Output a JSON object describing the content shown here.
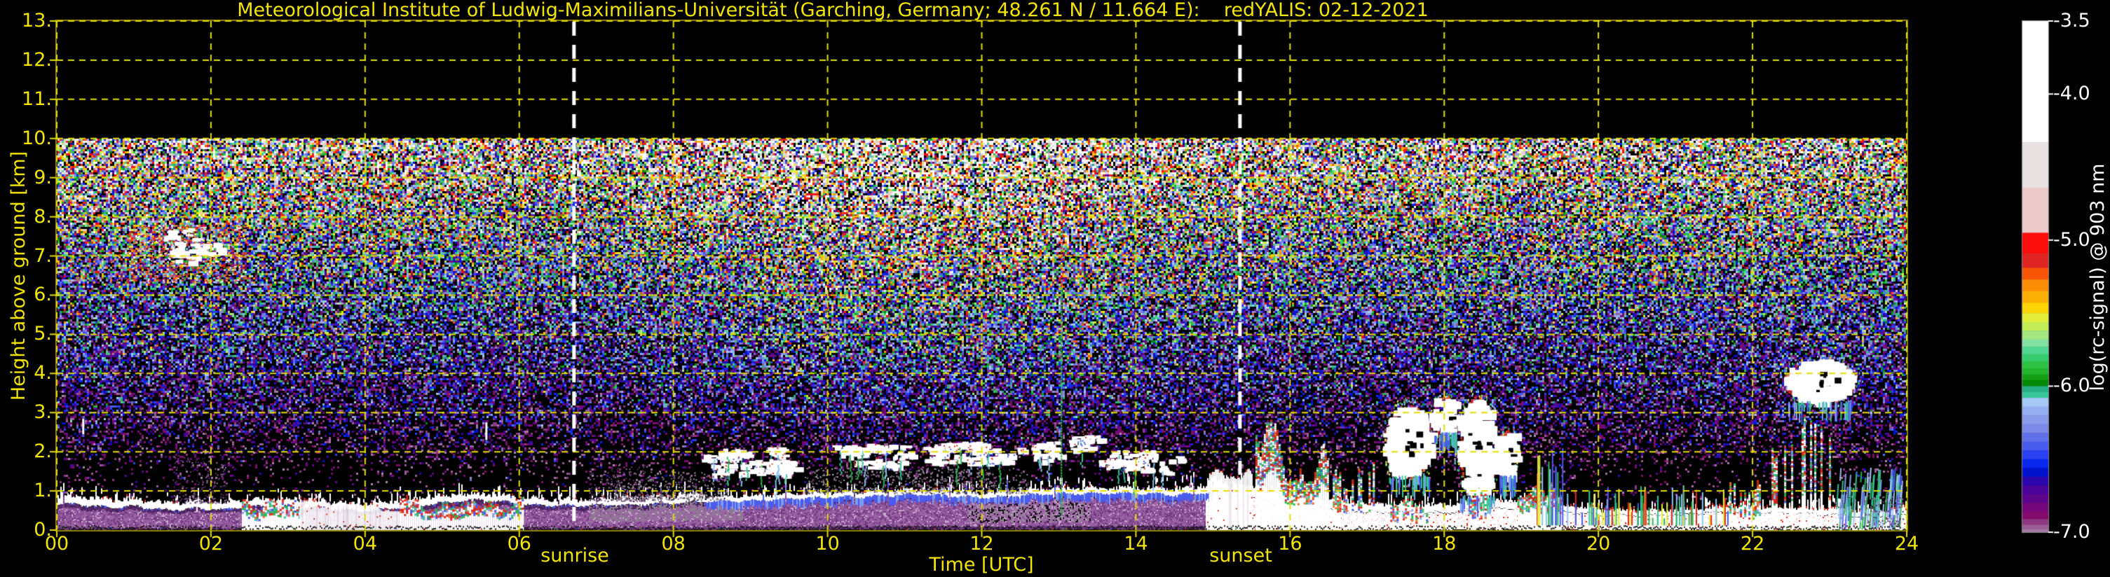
{
  "title": "Meteorological Institute of Ludwig-Maximilians-Universität (Garching, Germany; 48.261 N / 11.664 E):    redYALIS: 02-12-2021",
  "annotations": {
    "sunrise": "sunrise",
    "sunset": "sunset"
  },
  "colors": {
    "background": "#000000",
    "grid_yellow": "#e6de00",
    "spine_olive": "#8f8600",
    "text_yellow": "#f2e405",
    "text_white": "#ffffff",
    "sun_line_white": "#ffffff",
    "bl_purple": "#8a4f96"
  },
  "chart_data": {
    "type": "heatmap",
    "title": "Meteorological Institute of Ludwig-Maximilians-Universität (Garching, Germany; 48.261 N / 11.664 E):    redYALIS: 02-12-2021",
    "xlabel": "Time [UTC]",
    "ylabel": "Height above ground [km]",
    "colorbar_label": "log(rc-signal) @ 903 nm",
    "x_range_hours": [
      0,
      24
    ],
    "y_range_km": [
      0,
      13
    ],
    "data_top_km": 10,
    "grid": true,
    "x_ticks": [
      "00",
      "02",
      "04",
      "06",
      "08",
      "10",
      "12",
      "14",
      "16",
      "18",
      "20",
      "22",
      "24"
    ],
    "y_ticks": [
      "0.",
      "1.",
      "2.",
      "3.",
      "4.",
      "5.",
      "6.",
      "7.",
      "8.",
      "9.",
      "10.",
      "11.",
      "12.",
      "13."
    ],
    "colorbar_ticks": [
      "-3.5",
      "-4.0",
      "-5.0",
      "-6.0",
      "-7.0"
    ],
    "colorbar_tick_values": [
      -3.5,
      -4.0,
      -5.0,
      -6.0,
      -7.0
    ],
    "colorbar_range": [
      -3.5,
      -7.0
    ],
    "sunrise_hour": 6.71,
    "sunset_hour": 15.35,
    "colormap": [
      [
        -3.5,
        "#ffffff"
      ],
      [
        -4.33,
        "#e8e1e2"
      ],
      [
        -4.64,
        "#eccacb"
      ],
      [
        -4.95,
        "#fb0d0c"
      ],
      [
        -5.09,
        "#e02423"
      ],
      [
        -5.19,
        "#f85506"
      ],
      [
        -5.27,
        "#fb8e05"
      ],
      [
        -5.35,
        "#fcb004"
      ],
      [
        -5.43,
        "#fdd403"
      ],
      [
        -5.5,
        "#e4ee39"
      ],
      [
        -5.56,
        "#c4ec54"
      ],
      [
        -5.62,
        "#a3e682"
      ],
      [
        -5.68,
        "#83e1a2"
      ],
      [
        -5.73,
        "#53d794"
      ],
      [
        -5.78,
        "#36cb6c"
      ],
      [
        -5.83,
        "#2dc243"
      ],
      [
        -5.88,
        "#23b52b"
      ],
      [
        -5.92,
        "#12a012"
      ],
      [
        -5.96,
        "#058805"
      ],
      [
        -6.0,
        "#27af85"
      ],
      [
        -6.04,
        "#35c79a"
      ],
      [
        -6.08,
        "#a6c8f5"
      ],
      [
        -6.14,
        "#95aeef"
      ],
      [
        -6.2,
        "#899bea"
      ],
      [
        -6.26,
        "#7d89e7"
      ],
      [
        -6.32,
        "#6171e9"
      ],
      [
        -6.38,
        "#495bed"
      ],
      [
        -6.44,
        "#2941f1"
      ],
      [
        -6.5,
        "#0927ef"
      ],
      [
        -6.56,
        "#0113ce"
      ],
      [
        -6.62,
        "#2a06ac"
      ],
      [
        -6.68,
        "#49039a"
      ],
      [
        -6.74,
        "#5c058a"
      ],
      [
        -6.8,
        "#74077a"
      ],
      [
        -6.86,
        "#830b6b"
      ],
      [
        -6.91,
        "#8e3982"
      ],
      [
        -6.95,
        "#995d94"
      ],
      [
        -6.98,
        "#a278a2"
      ],
      [
        -7.0,
        "#a48baa"
      ]
    ],
    "noise_mean_profile": [
      [
        0,
        -7.5
      ],
      [
        0.8,
        -7.45
      ],
      [
        1.5,
        -7.38
      ],
      [
        2,
        -7.22
      ],
      [
        2.5,
        -7.15
      ],
      [
        3,
        -7.05
      ],
      [
        3.5,
        -6.98
      ],
      [
        4,
        -6.9
      ],
      [
        4.5,
        -6.82
      ],
      [
        5,
        -6.74
      ],
      [
        5.5,
        -6.65
      ],
      [
        6,
        -6.56
      ],
      [
        6.5,
        -6.46
      ],
      [
        7,
        -6.36
      ],
      [
        7.5,
        -6.25
      ],
      [
        8,
        -6.12
      ],
      [
        8.5,
        -5.98
      ],
      [
        9,
        -5.84
      ],
      [
        9.5,
        -5.7
      ],
      [
        10,
        -5.55
      ]
    ],
    "noise_sigma_profile": [
      [
        0,
        0.22
      ],
      [
        2,
        0.3
      ],
      [
        3,
        0.42
      ],
      [
        4,
        0.5
      ],
      [
        5,
        0.58
      ],
      [
        6,
        0.66
      ],
      [
        7,
        0.76
      ],
      [
        8,
        0.88
      ],
      [
        9,
        1.05
      ],
      [
        10,
        1.2
      ]
    ],
    "daytime": {
      "start": 7.0,
      "end": 15.7,
      "mean_boost": 0.55,
      "sigma_boost": 0.45
    },
    "boundary_layer": {
      "top_km": [
        [
          0,
          0.62
        ],
        [
          0.7,
          0.58
        ],
        [
          1.0,
          0.66
        ],
        [
          1.4,
          0.58
        ],
        [
          1.8,
          0.6
        ],
        [
          2.2,
          0.55
        ],
        [
          2.6,
          0.6
        ],
        [
          3.0,
          0.62
        ],
        [
          3.5,
          0.6
        ],
        [
          4.0,
          0.55
        ],
        [
          4.5,
          0.6
        ],
        [
          5.0,
          0.65
        ],
        [
          5.5,
          0.7
        ],
        [
          6.0,
          0.62
        ],
        [
          6.5,
          0.62
        ],
        [
          7.0,
          0.65
        ],
        [
          7.5,
          0.62
        ],
        [
          8.0,
          0.65
        ],
        [
          8.5,
          0.72
        ],
        [
          9.0,
          0.8
        ],
        [
          9.5,
          0.88
        ],
        [
          10.0,
          0.9
        ],
        [
          10.5,
          0.85
        ],
        [
          11.0,
          0.88
        ],
        [
          11.5,
          0.9
        ],
        [
          12.0,
          0.86
        ],
        [
          12.5,
          0.9
        ],
        [
          13.0,
          0.88
        ],
        [
          13.5,
          0.85
        ],
        [
          14.0,
          0.88
        ],
        [
          14.5,
          0.9
        ],
        [
          15.0,
          1.0
        ],
        [
          15.5,
          0.85
        ],
        [
          16.0,
          0.65
        ],
        [
          16.5,
          0.55
        ],
        [
          17.0,
          0.5
        ],
        [
          17.5,
          0.55
        ],
        [
          18.0,
          0.5
        ],
        [
          18.5,
          0.55
        ],
        [
          19.0,
          0.5
        ],
        [
          19.5,
          0.45
        ],
        [
          20.0,
          0.4
        ],
        [
          20.5,
          0.38
        ],
        [
          21.0,
          0.36
        ],
        [
          21.5,
          0.38
        ],
        [
          22.0,
          0.4
        ],
        [
          22.5,
          0.42
        ],
        [
          23.0,
          0.45
        ],
        [
          23.5,
          0.4
        ],
        [
          24,
          0.4
        ]
      ],
      "cap_thickness_km": [
        [
          0,
          0.2
        ],
        [
          3,
          0.18
        ],
        [
          6,
          0.16
        ],
        [
          8,
          0.18
        ],
        [
          9,
          0.24
        ],
        [
          10,
          0.22
        ],
        [
          12,
          0.24
        ],
        [
          14,
          0.26
        ],
        [
          15,
          0.3
        ],
        [
          16,
          0.28
        ],
        [
          17,
          0.22
        ],
        [
          19,
          0.18
        ],
        [
          20,
          0.14
        ],
        [
          21,
          0.12
        ],
        [
          22,
          0.12
        ],
        [
          23,
          0.14
        ],
        [
          24,
          0.14
        ]
      ],
      "white_from_hour": 14.9,
      "blue_fringe_hours": [
        8.4,
        15.0
      ]
    },
    "features": [
      {
        "kind": "thin-spike",
        "t": [
          0.33,
          0.38
        ],
        "h": [
          2.45,
          2.85
        ]
      },
      {
        "kind": "cirrus-sparse",
        "t": [
          0.15,
          0.85
        ],
        "h": [
          6.3,
          7.15
        ]
      },
      {
        "kind": "cirrus",
        "t": [
          0.9,
          2.45
        ],
        "h": [
          6.35,
          7.8
        ]
      },
      {
        "kind": "purple-haze",
        "t": [
          1.5,
          2.2
        ],
        "h": [
          0.7,
          2.0
        ]
      },
      {
        "kind": "precip-colorful",
        "t": [
          2.4,
          3.2
        ],
        "h": [
          0,
          1.25
        ]
      },
      {
        "kind": "precip-heavy",
        "t": [
          3.15,
          4.45
        ],
        "h": [
          0,
          0.8
        ]
      },
      {
        "kind": "precip-colorful",
        "t": [
          4.45,
          6.05
        ],
        "h": [
          0,
          1.35
        ]
      },
      {
        "kind": "thin-spike",
        "t": [
          5.56,
          5.62
        ],
        "h": [
          2.3,
          2.75
        ]
      },
      {
        "kind": "purple-haze",
        "t": [
          6.9,
          7.7
        ],
        "h": [
          0.75,
          1.7
        ]
      },
      {
        "kind": "gray-haze",
        "t": [
          7.2,
          8.7
        ],
        "h": [
          0.78,
          1.5
        ]
      },
      {
        "kind": "cu-fragments",
        "t": [
          8.3,
          9.6
        ],
        "h": [
          1.45,
          2.05
        ]
      },
      {
        "kind": "gray-haze",
        "t": [
          9.7,
          12.6
        ],
        "h": [
          0.95,
          1.6
        ]
      },
      {
        "kind": "cu-fragments",
        "t": [
          10.1,
          11.0
        ],
        "h": [
          1.7,
          2.2
        ]
      },
      {
        "kind": "cu-fragments",
        "t": [
          11.3,
          12.9
        ],
        "h": [
          1.75,
          2.2
        ]
      },
      {
        "kind": "artifact-column",
        "t": [
          13.0,
          13.05
        ],
        "h": [
          0.4,
          9.8
        ]
      },
      {
        "kind": "cu-fragments",
        "t": [
          13.2,
          13.45
        ],
        "h": [
          2.0,
          2.5
        ]
      },
      {
        "kind": "cu-fragments",
        "t": [
          13.6,
          14.45
        ],
        "h": [
          1.55,
          2.0
        ]
      },
      {
        "kind": "precip-heavy",
        "t": [
          14.95,
          15.5
        ],
        "h": [
          0,
          1.55
        ]
      },
      {
        "kind": "precip-colorful",
        "t": [
          15.55,
          16.5
        ],
        "h": [
          0,
          3.4
        ]
      },
      {
        "kind": "precip-colorful",
        "t": [
          16.5,
          17.15
        ],
        "h": [
          0,
          2.2
        ],
        "sparse": true
      },
      {
        "kind": "cloud-mass",
        "t": [
          17.25,
          17.8
        ],
        "h": [
          1.4,
          3.1
        ]
      },
      {
        "kind": "precip-colorful",
        "t": [
          17.3,
          17.78
        ],
        "h": [
          0,
          1.4
        ],
        "sparse": true
      },
      {
        "kind": "cloud-small",
        "t": [
          17.85,
          18.15
        ],
        "h": [
          2.5,
          3.4
        ]
      },
      {
        "kind": "cloud-mass",
        "t": [
          18.2,
          18.65
        ],
        "h": [
          0.9,
          3.3
        ]
      },
      {
        "kind": "precip-colorful",
        "t": [
          18.25,
          18.6
        ],
        "h": [
          0,
          0.95
        ],
        "sparse": true
      },
      {
        "kind": "cloud-small",
        "t": [
          18.7,
          18.92
        ],
        "h": [
          1.4,
          2.5
        ]
      },
      {
        "kind": "precip-colorful",
        "t": [
          18.95,
          19.5
        ],
        "h": [
          0,
          2.4
        ]
      },
      {
        "kind": "spikes-cyan",
        "t": [
          19.15,
          19.7
        ],
        "h": [
          0.5,
          2.3
        ]
      },
      {
        "kind": "spikes-cyan",
        "t": [
          19.75,
          21.7
        ],
        "h": [
          0.3,
          1.15
        ]
      },
      {
        "kind": "precip-colorful",
        "t": [
          21.7,
          22.45
        ],
        "h": [
          0,
          2.6
        ],
        "sparse": true
      },
      {
        "kind": "cloud-mass",
        "t": [
          22.45,
          23.3
        ],
        "h": [
          3.3,
          4.3
        ]
      },
      {
        "kind": "precip-colorful",
        "t": [
          22.5,
          23.1
        ],
        "h": [
          0,
          3.3
        ],
        "sparse": true
      },
      {
        "kind": "virga-blue",
        "t": [
          23.1,
          23.95
        ],
        "h": [
          0.2,
          1.6
        ]
      },
      {
        "kind": "purple-haze",
        "t": [
          23.45,
          23.95
        ],
        "h": [
          0.15,
          0.9
        ]
      }
    ]
  }
}
